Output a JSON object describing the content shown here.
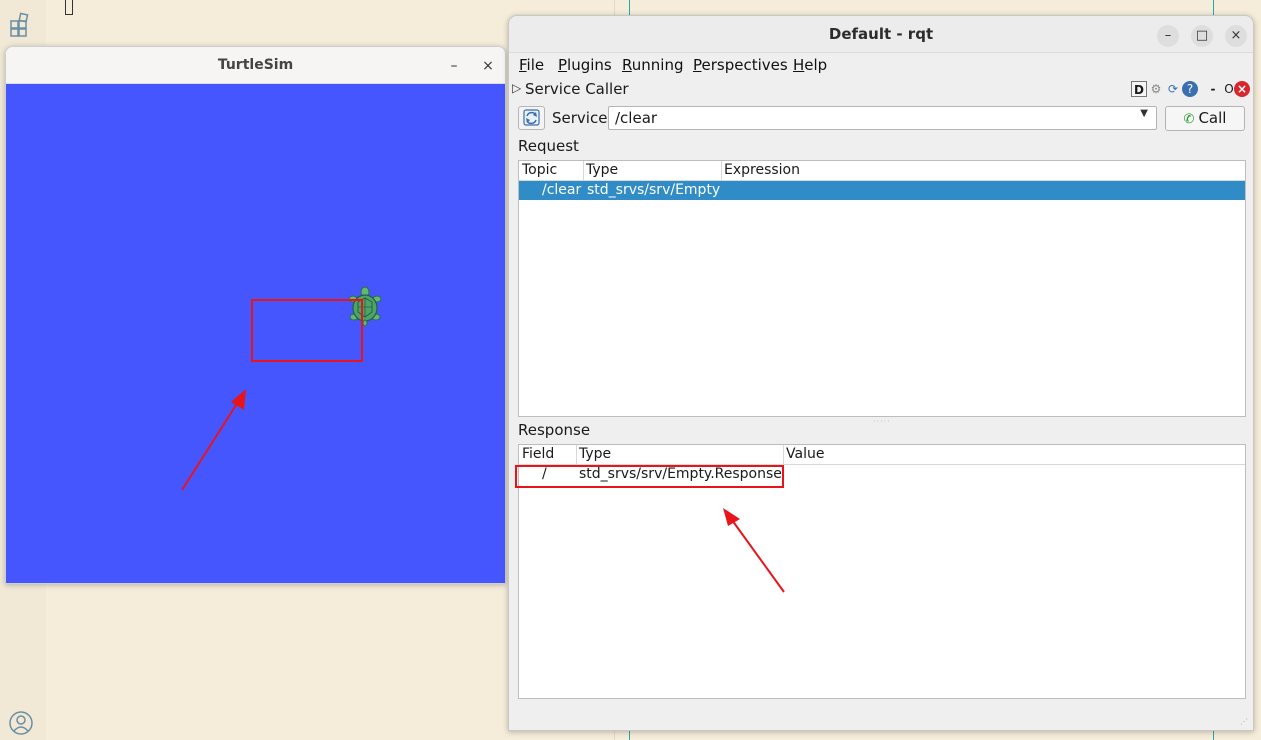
{
  "turtlesim": {
    "title": "TurtleSim",
    "minimize": "–",
    "close": "×",
    "background_color": "#4556ff"
  },
  "rqt": {
    "title": "Default - rqt",
    "minimize": "–",
    "maximize": "□",
    "close": "×",
    "menu": [
      "File",
      "Plugins",
      "Running",
      "Perspectives",
      "Help"
    ],
    "plugin": {
      "title": "Service Caller",
      "toolbar": [
        "D",
        "gear-icon",
        "reload-icon",
        "help-icon",
        "-",
        "O",
        "close-icon"
      ]
    },
    "service": {
      "label": "Service",
      "value": "/clear",
      "call_label": "Call"
    },
    "request": {
      "label": "Request",
      "columns": [
        "Topic",
        "Type",
        "Expression"
      ],
      "rows": [
        {
          "topic": "/clear",
          "type": "std_srvs/srv/Empty",
          "expression": ""
        }
      ]
    },
    "response": {
      "label": "Response",
      "columns": [
        "Field",
        "Type",
        "Value"
      ],
      "rows": [
        {
          "field": "/",
          "type": "std_srvs/srv/Empty.Response",
          "value": ""
        }
      ]
    }
  },
  "annotation_color": "#e8141a"
}
